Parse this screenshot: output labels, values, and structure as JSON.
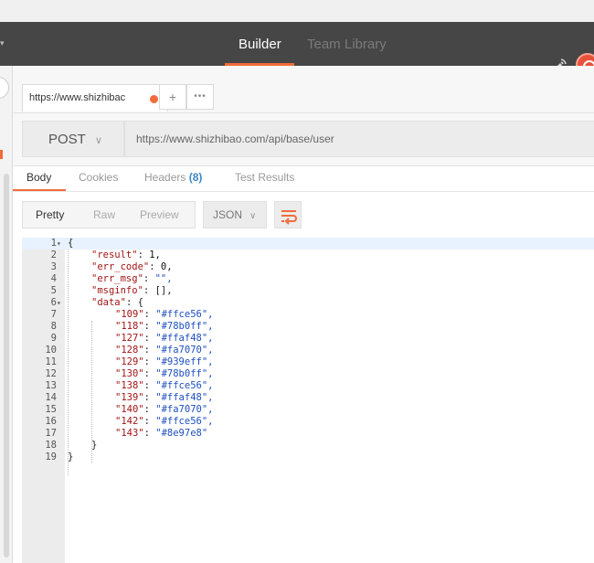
{
  "header": {
    "tabs": [
      {
        "label": "Builder",
        "active": true
      },
      {
        "label": "Team Library",
        "active": false
      }
    ],
    "accent_color": "#f26b3a"
  },
  "request_tab": {
    "url_short": "https://www.shizhibac",
    "plus_label": "+",
    "more_label": "•••"
  },
  "request": {
    "method": "POST",
    "url": "https://www.shizhibao.com/api/base/user"
  },
  "subtabs": {
    "body": "Body",
    "cookies": "Cookies",
    "headers": "Headers",
    "headers_count": "(8)",
    "tests": "Test Results"
  },
  "response": {
    "formats": [
      "Pretty",
      "Raw",
      "Preview"
    ],
    "type": "JSON"
  },
  "json_lines": [
    {
      "n": "1",
      "fold": true,
      "indent": 0,
      "key": "",
      "value": "{",
      "vtype": "p"
    },
    {
      "n": "2",
      "fold": false,
      "indent": 1,
      "key": "\"result\"",
      "value": "1,",
      "vtype": "n"
    },
    {
      "n": "3",
      "fold": false,
      "indent": 1,
      "key": "\"err_code\"",
      "value": "0,",
      "vtype": "n"
    },
    {
      "n": "4",
      "fold": false,
      "indent": 1,
      "key": "\"err_msg\"",
      "value": "\"\",",
      "vtype": "s"
    },
    {
      "n": "5",
      "fold": false,
      "indent": 1,
      "key": "\"msginfo\"",
      "value": "[],",
      "vtype": "p"
    },
    {
      "n": "6",
      "fold": true,
      "indent": 1,
      "key": "\"data\"",
      "value": "{",
      "vtype": "p"
    },
    {
      "n": "7",
      "fold": false,
      "indent": 2,
      "key": "\"109\"",
      "value": "\"#ffce56\",",
      "vtype": "s"
    },
    {
      "n": "8",
      "fold": false,
      "indent": 2,
      "key": "\"118\"",
      "value": "\"#78b0ff\",",
      "vtype": "s"
    },
    {
      "n": "9",
      "fold": false,
      "indent": 2,
      "key": "\"127\"",
      "value": "\"#ffaf48\",",
      "vtype": "s"
    },
    {
      "n": "10",
      "fold": false,
      "indent": 2,
      "key": "\"128\"",
      "value": "\"#fa7070\",",
      "vtype": "s"
    },
    {
      "n": "11",
      "fold": false,
      "indent": 2,
      "key": "\"129\"",
      "value": "\"#939eff\",",
      "vtype": "s"
    },
    {
      "n": "12",
      "fold": false,
      "indent": 2,
      "key": "\"130\"",
      "value": "\"#78b0ff\",",
      "vtype": "s"
    },
    {
      "n": "13",
      "fold": false,
      "indent": 2,
      "key": "\"138\"",
      "value": "\"#ffce56\",",
      "vtype": "s"
    },
    {
      "n": "14",
      "fold": false,
      "indent": 2,
      "key": "\"139\"",
      "value": "\"#ffaf48\",",
      "vtype": "s"
    },
    {
      "n": "15",
      "fold": false,
      "indent": 2,
      "key": "\"140\"",
      "value": "\"#fa7070\",",
      "vtype": "s"
    },
    {
      "n": "16",
      "fold": false,
      "indent": 2,
      "key": "\"142\"",
      "value": "\"#ffce56\",",
      "vtype": "s"
    },
    {
      "n": "17",
      "fold": false,
      "indent": 2,
      "key": "\"143\"",
      "value": "\"#8e97e8\"",
      "vtype": "s"
    },
    {
      "n": "18",
      "fold": false,
      "indent": 1,
      "key": "",
      "value": "}",
      "vtype": "p"
    },
    {
      "n": "19",
      "fold": false,
      "indent": 0,
      "key": "",
      "value": "}",
      "vtype": "p"
    }
  ]
}
